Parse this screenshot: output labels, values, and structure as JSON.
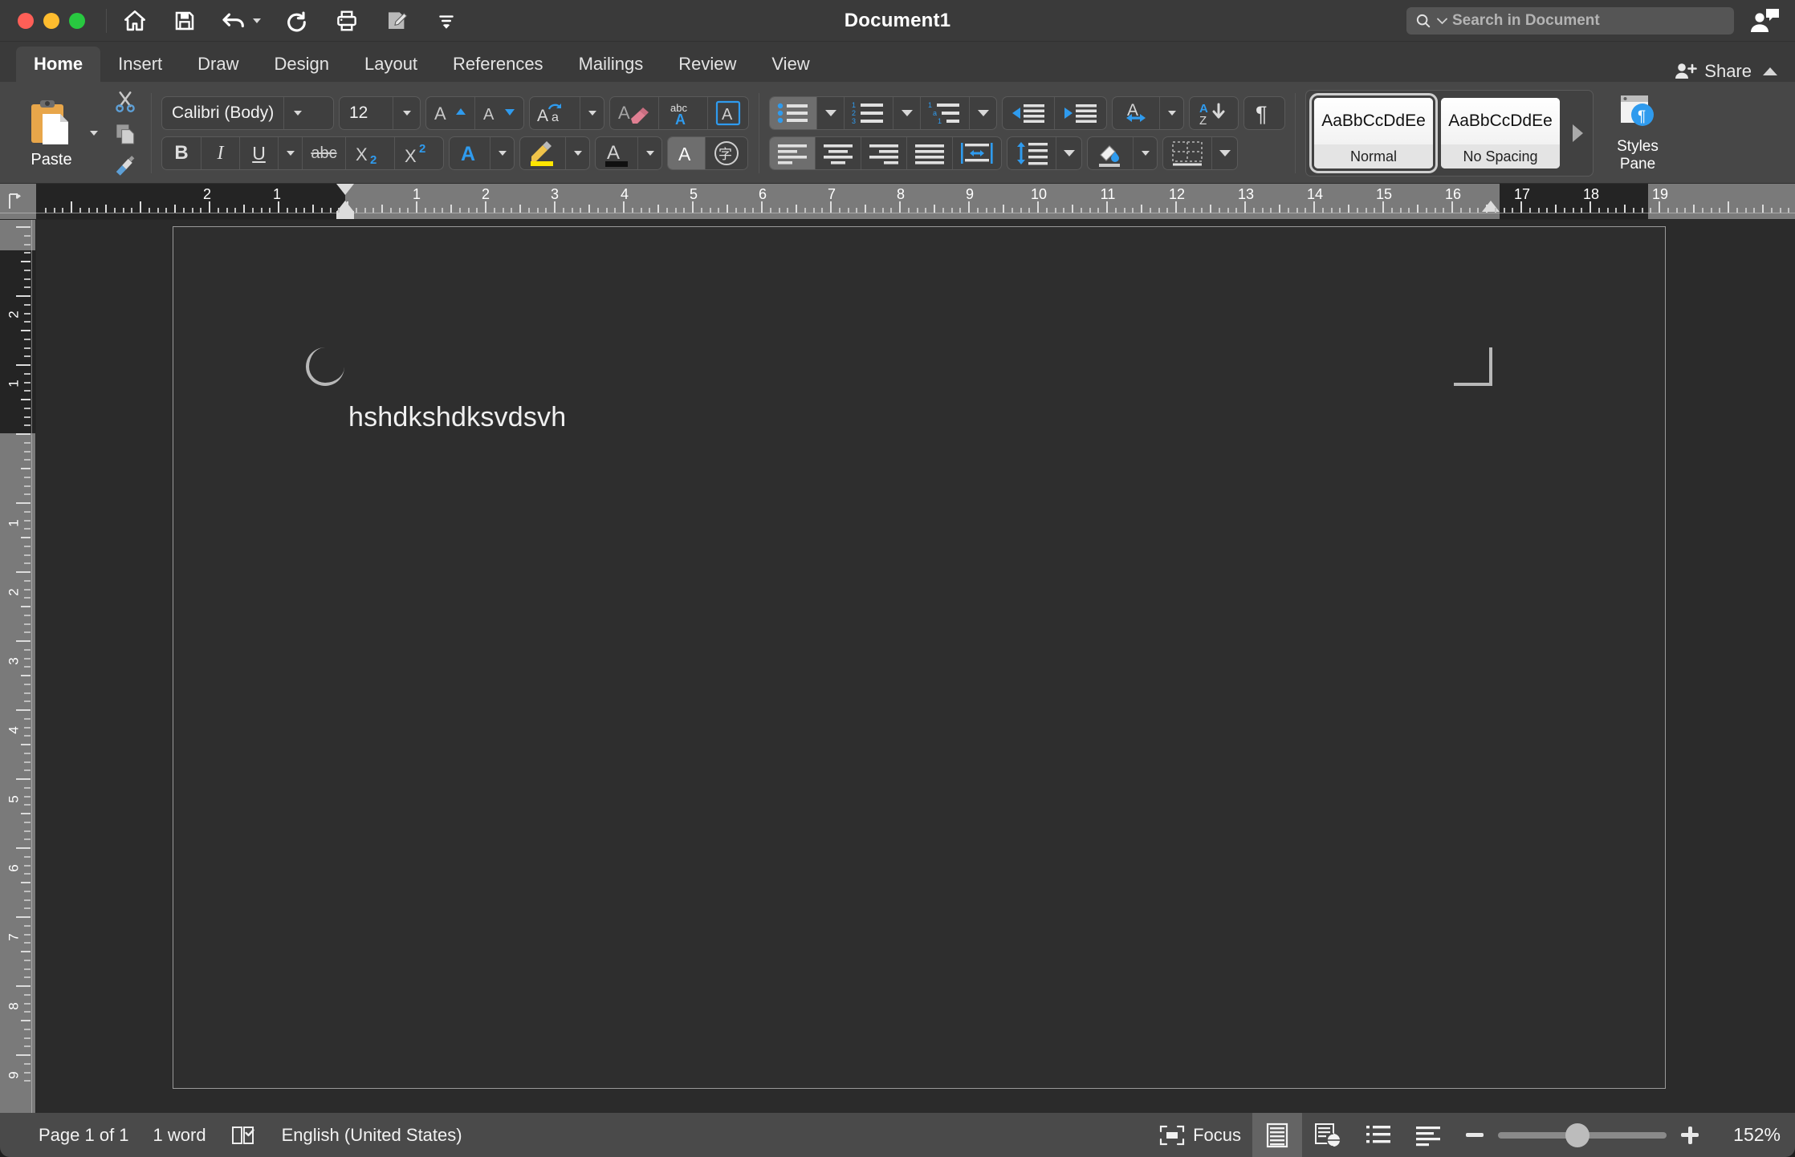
{
  "window": {
    "title": "Document1",
    "traffic_lights": [
      "close",
      "minimize",
      "maximize"
    ]
  },
  "quick_access": {
    "items": [
      {
        "name": "home-icon",
        "label": "Home"
      },
      {
        "name": "save-icon",
        "label": "Save"
      },
      {
        "name": "undo-icon",
        "label": "Undo"
      },
      {
        "name": "redo-icon",
        "label": "Redo"
      },
      {
        "name": "print-icon",
        "label": "Print"
      },
      {
        "name": "track-changes-icon",
        "label": "Track Changes"
      },
      {
        "name": "customize-toolbar-icon",
        "label": "Customize Toolbar"
      }
    ]
  },
  "search": {
    "placeholder": "Search in Document",
    "icon": "search-icon"
  },
  "account": {
    "icon": "account-icon"
  },
  "tabs": {
    "items": [
      {
        "label": "Home",
        "active": true
      },
      {
        "label": "Insert",
        "active": false
      },
      {
        "label": "Draw",
        "active": false
      },
      {
        "label": "Design",
        "active": false
      },
      {
        "label": "Layout",
        "active": false
      },
      {
        "label": "References",
        "active": false
      },
      {
        "label": "Mailings",
        "active": false
      },
      {
        "label": "Review",
        "active": false
      },
      {
        "label": "View",
        "active": false
      }
    ]
  },
  "share": {
    "label": "Share",
    "icon": "person-plus-icon",
    "collapse_icon": "chevron-up-icon"
  },
  "ribbon": {
    "clipboard": {
      "paste_label": "Paste",
      "paste_icon": "clipboard-icon",
      "cut_icon": "scissors-icon",
      "copy_icon": "copy-icon",
      "format_painter_icon": "paintbrush-icon"
    },
    "font": {
      "font_family": "Calibri (Body)",
      "font_size": "12",
      "grow_font_icon": "grow-font-icon",
      "shrink_font_icon": "shrink-font-icon",
      "change_case_icon": "change-case-icon",
      "clear_formatting_icon": "clear-formatting-icon",
      "spelling_icon": "spelling-abc-icon",
      "text_effects_icon": "text-effects-icon",
      "bold": "B",
      "italic": "I",
      "underline": "U",
      "strikethrough": "abc",
      "subscript": "X₂",
      "superscript": "X²",
      "font_color_icon": "font-color-icon",
      "highlight_icon": "highlight-icon",
      "text_shading_icon": "text-shading-icon",
      "text_highlight_a_icon": "character-shading-icon",
      "phonetic_guide_icon": "phonetic-guide-icon"
    },
    "paragraph": {
      "bullets_icon": "bullet-list-icon",
      "numbering_icon": "numbered-list-icon",
      "multilevel_icon": "multilevel-list-icon",
      "decrease_indent_icon": "decrease-indent-icon",
      "increase_indent_icon": "increase-indent-icon",
      "ltr_rtl_icon": "text-direction-icon",
      "sort_icon": "sort-az-icon",
      "show_marks_icon": "pilcrow-icon",
      "align_left_icon": "align-left-icon",
      "align_center_icon": "align-center-icon",
      "align_right_icon": "align-right-icon",
      "justify_icon": "justify-icon",
      "distribute_icon": "distribute-icon",
      "line_spacing_icon": "line-spacing-icon",
      "shading_icon": "shading-icon",
      "borders_icon": "borders-icon"
    },
    "styles": {
      "gallery": [
        {
          "preview": "AaBbCcDdEe",
          "name": "Normal",
          "selected": true
        },
        {
          "preview": "AaBbCcDdEe",
          "name": "No Spacing",
          "selected": false
        }
      ],
      "more_arrow_icon": "gallery-more-icon",
      "pane_label_line1": "Styles",
      "pane_label_line2": "Pane",
      "pane_icon": "styles-pane-icon"
    }
  },
  "ruler": {
    "horizontal_labels": [
      "2",
      "1",
      "1",
      "2",
      "3",
      "4",
      "5",
      "6",
      "7",
      "8",
      "9",
      "10",
      "11",
      "12",
      "13",
      "14",
      "15",
      "16",
      "17",
      "18",
      "19"
    ],
    "vertical_labels": [
      "2",
      "1",
      "1",
      "2",
      "3",
      "4",
      "5",
      "6",
      "7",
      "8",
      "9"
    ],
    "tab_stop_icon": "left-tab-stop-icon",
    "first_line_indent_icon": "first-line-indent-marker",
    "hanging_indent_icon": "hanging-indent-marker",
    "right_indent_icon": "right-indent-marker"
  },
  "document": {
    "body_text": "hshdkshdksvdsvh",
    "margin_markers": [
      "top-left-margin-corner",
      "top-right-margin-corner"
    ]
  },
  "status": {
    "page": "Page 1 of 1",
    "words": "1 word",
    "proofing_icon": "proofing-icon",
    "language": "English (United States)",
    "focus_label": "Focus",
    "focus_icon": "focus-icon",
    "views": [
      {
        "name": "print-layout-view",
        "icon": "print-layout-icon",
        "active": true
      },
      {
        "name": "web-layout-view",
        "icon": "web-layout-icon",
        "active": false
      },
      {
        "name": "outline-view",
        "icon": "outline-icon",
        "active": false
      },
      {
        "name": "draft-view",
        "icon": "draft-icon",
        "active": false
      }
    ],
    "zoom_out_icon": "zoom-out-icon",
    "zoom_in_icon": "zoom-in-icon",
    "zoom_level": "152%"
  },
  "colors": {
    "titlebar": "#3a3a3a",
    "ribbon": "#474747",
    "canvas": "#2b2b2b",
    "page": "#2e2e2e",
    "accent_blue": "#2f9bee",
    "status_bar": "#4a4a4a"
  }
}
